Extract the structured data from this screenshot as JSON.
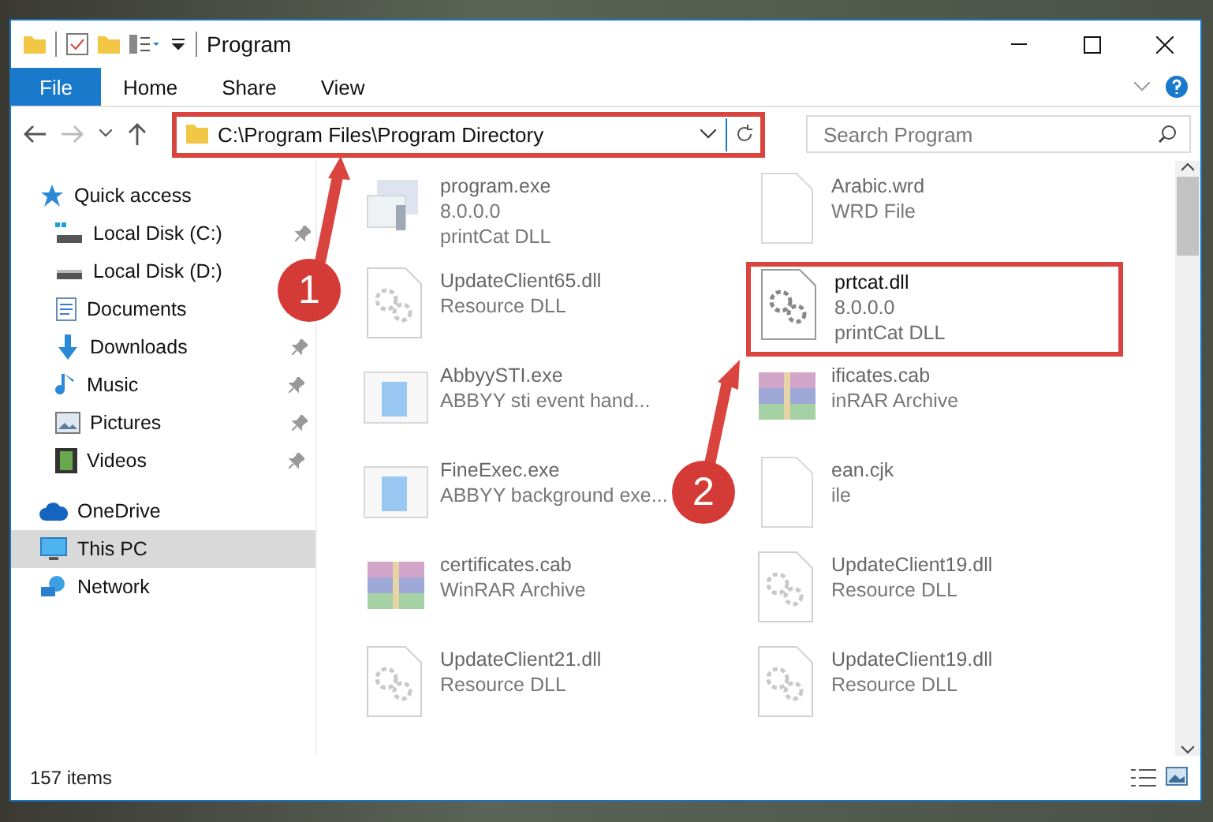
{
  "window": {
    "title": "Program"
  },
  "ribbon_tabs": [
    {
      "label": "File",
      "selected": true
    },
    {
      "label": "Home",
      "selected": false
    },
    {
      "label": "Share",
      "selected": false
    },
    {
      "label": "View",
      "selected": false
    }
  ],
  "address": {
    "path": "C:\\Program Files\\Program Directory",
    "highlighted": true
  },
  "search": {
    "placeholder": "Search Program"
  },
  "sidebar": {
    "groups": [
      {
        "items": [
          {
            "label": "Quick access",
            "kind": "star",
            "pinned": false,
            "selected": false
          },
          {
            "label": "Local Disk (C:)",
            "kind": "windrive",
            "pinned": true,
            "selected": false
          },
          {
            "label": "Local Disk (D:)",
            "kind": "drive",
            "pinned": false,
            "selected": false
          },
          {
            "label": "Documents",
            "kind": "documents",
            "pinned": false,
            "selected": false
          },
          {
            "label": "Downloads",
            "kind": "downloads",
            "pinned": true,
            "selected": false
          },
          {
            "label": "Music",
            "kind": "music",
            "pinned": true,
            "selected": false
          },
          {
            "label": "Pictures",
            "kind": "pictures",
            "pinned": true,
            "selected": false
          },
          {
            "label": "Videos",
            "kind": "videos",
            "pinned": true,
            "selected": false
          }
        ]
      },
      {
        "items": [
          {
            "label": "OneDrive",
            "kind": "cloud",
            "pinned": false,
            "selected": false
          },
          {
            "label": "This PC",
            "kind": "pc",
            "pinned": false,
            "selected": true
          },
          {
            "label": "Network",
            "kind": "network",
            "pinned": false,
            "selected": false
          }
        ]
      }
    ]
  },
  "files": [
    {
      "name": "program.exe",
      "details": [
        "8.0.0.0",
        "printCat DLL"
      ],
      "kind": "app",
      "blurred": true,
      "highlighted": false
    },
    {
      "name": "Arabic.wrd",
      "details": [
        "WRD File"
      ],
      "kind": "blank",
      "blurred": true,
      "highlighted": false
    },
    {
      "name": "UpdateClient65.dll",
      "details": [
        "Resource DLL"
      ],
      "kind": "dll",
      "blurred": true,
      "highlighted": false
    },
    {
      "name": "prtcat.dll",
      "details": [
        "8.0.0.0",
        "printCat DLL"
      ],
      "kind": "dll",
      "blurred": false,
      "highlighted": true
    },
    {
      "name": "AbbyySTI.exe",
      "details": [
        "ABBYY sti event hand..."
      ],
      "kind": "window",
      "blurred": true,
      "highlighted": false
    },
    {
      "name": "ificates.cab",
      "details": [
        "inRAR Archive"
      ],
      "kind": "archive",
      "blurred": true,
      "highlighted": false
    },
    {
      "name": "FineExec.exe",
      "details": [
        "ABBYY background exe..."
      ],
      "kind": "window",
      "blurred": true,
      "highlighted": false
    },
    {
      "name": "ean.cjk",
      "details": [
        "ile"
      ],
      "kind": "blank",
      "blurred": true,
      "highlighted": false
    },
    {
      "name": "certificates.cab",
      "details": [
        "WinRAR Archive"
      ],
      "kind": "archive",
      "blurred": true,
      "highlighted": false
    },
    {
      "name": "UpdateClient19.dll",
      "details": [
        "Resource DLL"
      ],
      "kind": "dll",
      "blurred": true,
      "highlighted": false
    },
    {
      "name": "UpdateClient21.dll",
      "details": [
        "Resource DLL"
      ],
      "kind": "dll",
      "blurred": true,
      "highlighted": false
    },
    {
      "name": "UpdateClient19.dll",
      "details": [
        "Resource DLL"
      ],
      "kind": "dll",
      "blurred": true,
      "highlighted": false
    }
  ],
  "annotations": [
    {
      "number": "1"
    },
    {
      "number": "2"
    }
  ],
  "status_bar": {
    "count": "157 items"
  }
}
